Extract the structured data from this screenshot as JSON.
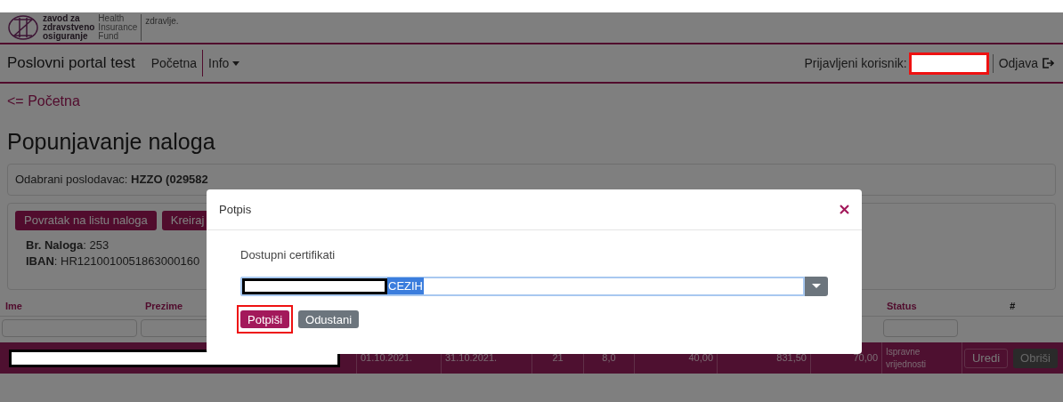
{
  "logo": {
    "lines_local": [
      "zavod za",
      "zdravstveno",
      "osiguranje"
    ],
    "lines_en": [
      "Health",
      "Insurance",
      "Fund"
    ],
    "tagline": "zdravlje."
  },
  "navbar": {
    "brand": "Poslovni portal test",
    "links": [
      {
        "label": "Početna",
        "kind": "link"
      },
      {
        "label": "Info",
        "kind": "dropdown"
      }
    ],
    "user_label": "Prijavljeni korisnik:",
    "logout": "Odjava"
  },
  "back_link": "<= Početna",
  "heading": "Popunjavanje naloga",
  "employer": {
    "label": "Odabrani poslodavac:",
    "value": "HZZO (029582"
  },
  "actions": [
    "Povratak na listu naloga",
    "Kreiraj"
  ],
  "details": [
    "**Br. Naloga**: 253",
    "**IBAN**: HR1210010051863000160"
  ],
  "table": {
    "headers_left": [
      "Ime",
      "Prezime"
    ],
    "headers_right": [
      "Status",
      "#"
    ],
    "row": {
      "cells": [
        "01.10.2021.",
        "31.10.2021.",
        "21",
        "8,0",
        "40,00",
        "831,50",
        "70,00"
      ],
      "status": "Ispravne vrijednosti",
      "buttons": [
        {
          "label": "Uredi",
          "kind": "outline"
        },
        {
          "label": "Obriši",
          "kind": "dark"
        }
      ]
    }
  },
  "modal": {
    "title": "Potpis",
    "label": "Dostupni certifikati",
    "select_text": "CEZIH",
    "buttons": [
      {
        "label": "Potpiši",
        "kind": "primary",
        "highlighted": true
      },
      {
        "label": "Odustani",
        "kind": "secondary",
        "highlighted": false
      }
    ]
  }
}
